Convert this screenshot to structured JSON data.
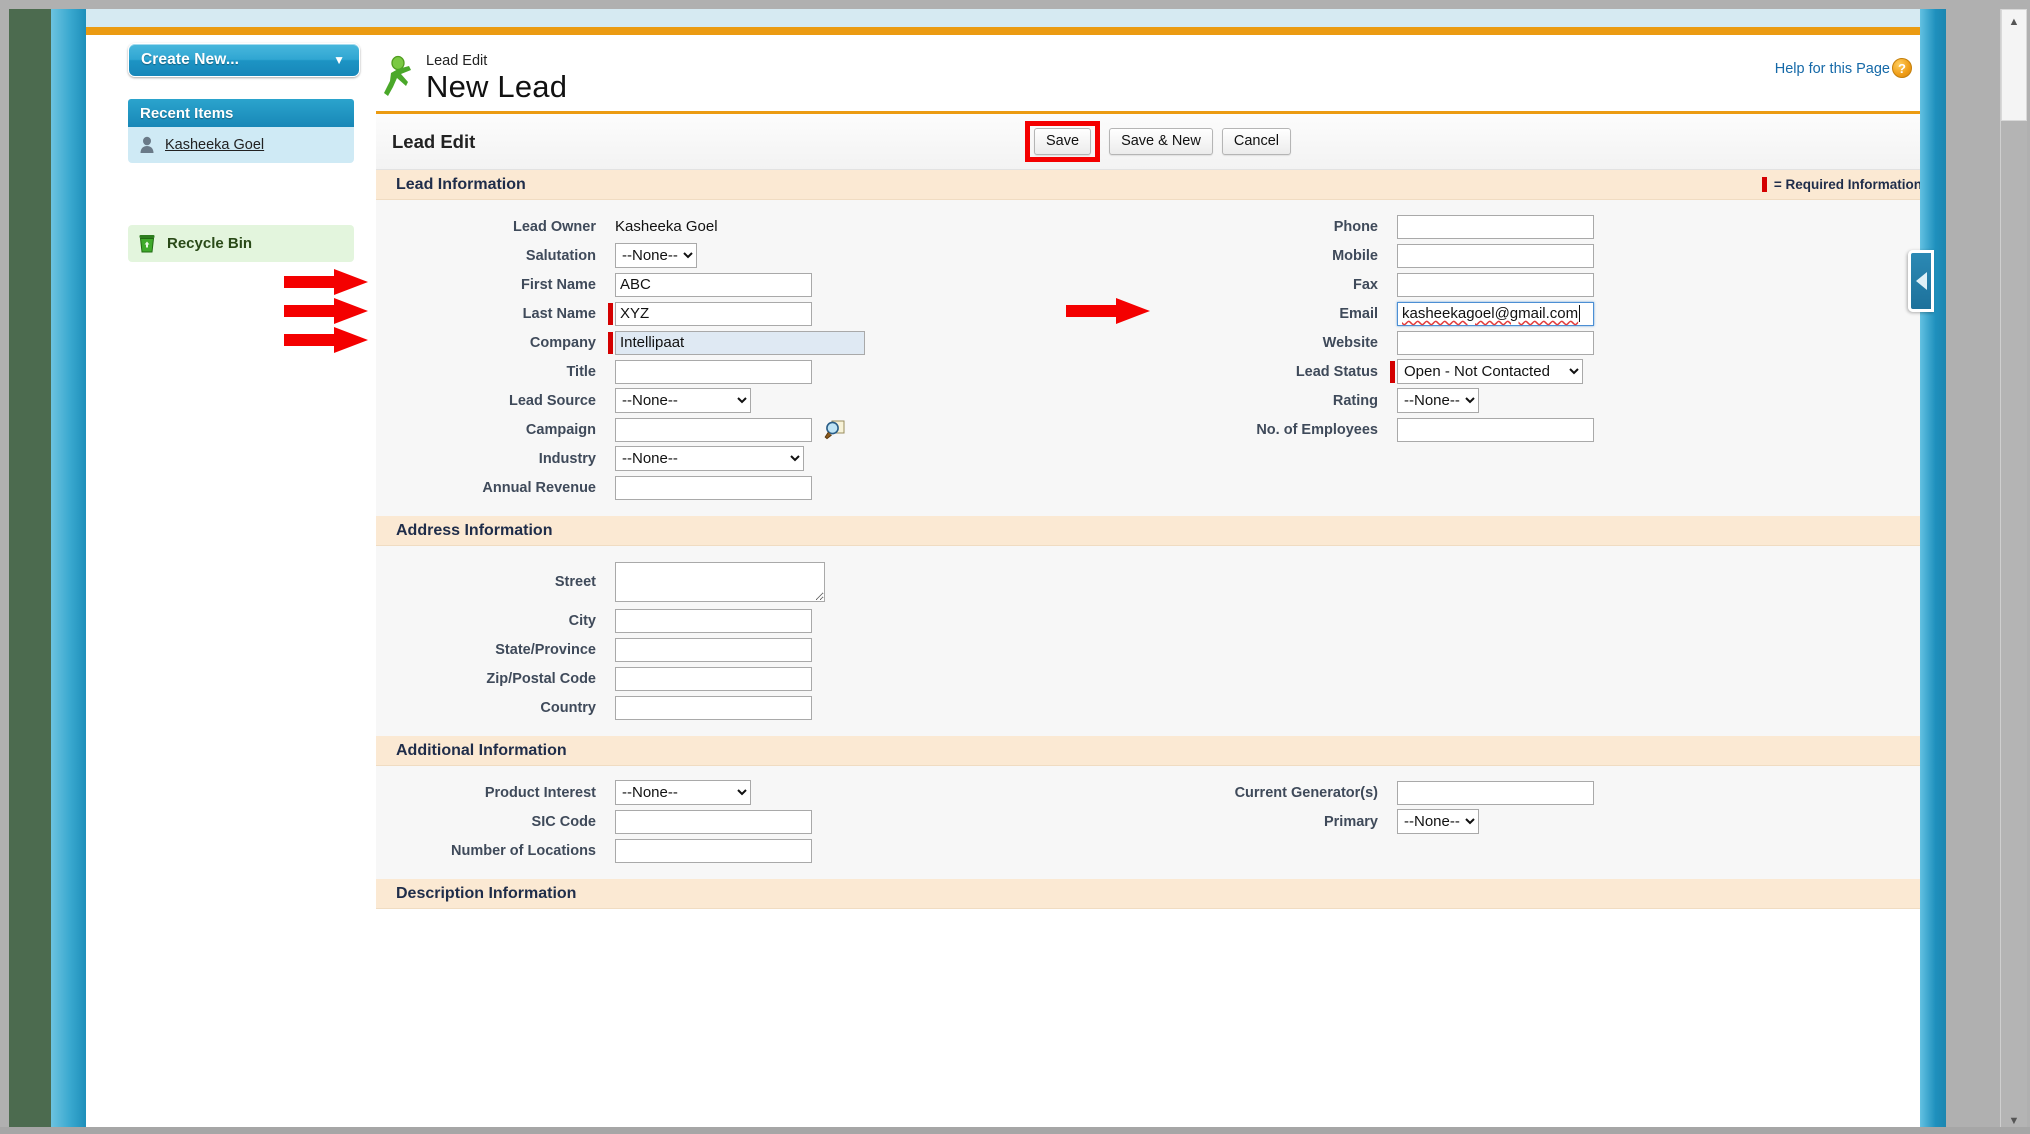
{
  "browser": {
    "scrollbar": {
      "up_arrow": "▲",
      "down_arrow": "▼"
    },
    "collapse_tab": "◀"
  },
  "sidebar": {
    "create_new": {
      "label": "Create New...",
      "caret": "▼"
    },
    "recent_items": {
      "header": "Recent Items",
      "items": [
        {
          "label": "Kasheeka Goel",
          "icon": "user-icon"
        }
      ]
    },
    "recycle_bin": {
      "label": "Recycle Bin",
      "icon": "recycle-bin-icon"
    }
  },
  "header": {
    "subtitle": "Lead Edit",
    "title": "New Lead",
    "help_link": "Help for this Page",
    "help_badge": "?"
  },
  "toolbar": {
    "title": "Lead Edit",
    "save_label": "Save",
    "save_new_label": "Save & New",
    "cancel_label": "Cancel",
    "highlight_color": "#f40000"
  },
  "required_legend": "= Required Information",
  "sections": {
    "lead_information": {
      "header": "Lead Information",
      "left": [
        {
          "label": "Lead Owner",
          "type": "readonly",
          "value": "Kasheeka Goel",
          "required": false
        },
        {
          "label": "Salutation",
          "type": "select",
          "value": "--None--",
          "size": "sm",
          "required": false
        },
        {
          "label": "First Name",
          "type": "text",
          "value": "ABC",
          "required": false,
          "arrow": true
        },
        {
          "label": "Last Name",
          "type": "text",
          "value": "XYZ",
          "required": true,
          "arrow": true
        },
        {
          "label": "Company",
          "type": "text",
          "value": "Intellipaat",
          "required": true,
          "arrow": true,
          "highlight": true
        },
        {
          "label": "Title",
          "type": "text",
          "value": "",
          "required": false
        },
        {
          "label": "Lead Source",
          "type": "select",
          "value": "--None--",
          "size": "md",
          "required": false
        },
        {
          "label": "Campaign",
          "type": "text",
          "value": "",
          "required": false,
          "lookup": true
        },
        {
          "label": "Industry",
          "type": "select",
          "value": "--None--",
          "size": "lg",
          "required": false
        },
        {
          "label": "Annual Revenue",
          "type": "text",
          "value": "",
          "required": false
        }
      ],
      "right": [
        {
          "label": "Phone",
          "type": "text",
          "value": "",
          "required": false
        },
        {
          "label": "Mobile",
          "type": "text",
          "value": "",
          "required": false
        },
        {
          "label": "Fax",
          "type": "text",
          "value": "",
          "required": false
        },
        {
          "label": "Email",
          "type": "text",
          "value": "kasheekagoel@gmail.com",
          "required": false,
          "arrow": true,
          "focused": true
        },
        {
          "label": "Website",
          "type": "text",
          "value": "",
          "required": false
        },
        {
          "label": "Lead Status",
          "type": "select",
          "value": "Open - Not Contacted",
          "size": "xl2",
          "required": true
        },
        {
          "label": "Rating",
          "type": "select",
          "value": "--None--",
          "size": "sm",
          "required": false
        },
        {
          "label": "No. of Employees",
          "type": "text",
          "value": "",
          "required": false
        }
      ]
    },
    "address_information": {
      "header": "Address Information",
      "left": [
        {
          "label": "Street",
          "type": "textarea",
          "value": ""
        },
        {
          "label": "City",
          "type": "text",
          "value": ""
        },
        {
          "label": "State/Province",
          "type": "text",
          "value": ""
        },
        {
          "label": "Zip/Postal Code",
          "type": "text",
          "value": ""
        },
        {
          "label": "Country",
          "type": "text",
          "value": ""
        }
      ]
    },
    "additional_information": {
      "header": "Additional Information",
      "left": [
        {
          "label": "Product Interest",
          "type": "select",
          "value": "--None--",
          "size": "md"
        },
        {
          "label": "SIC Code",
          "type": "text",
          "value": ""
        },
        {
          "label": "Number of Locations",
          "type": "text",
          "value": ""
        }
      ],
      "right": [
        {
          "label": "Current Generator(s)",
          "type": "text",
          "value": ""
        },
        {
          "label": "Primary",
          "type": "select",
          "value": "--None--",
          "size": "sm"
        }
      ]
    },
    "description_information": {
      "header": "Description Information"
    }
  }
}
